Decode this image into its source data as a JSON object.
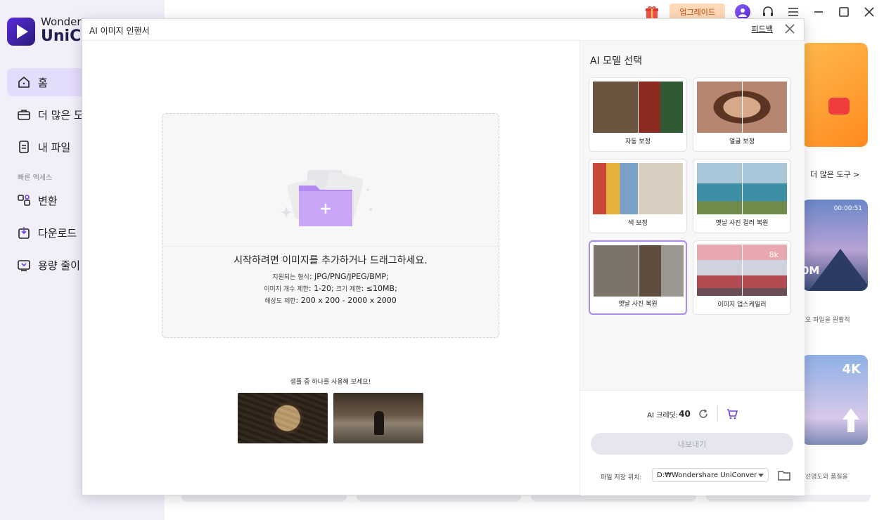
{
  "app": {
    "brand_line1": "Wonders",
    "brand_line2": "UniCo",
    "upgrade_label": "업그레이드",
    "accent_color": "#6b3fe0"
  },
  "sidebar": {
    "items": [
      {
        "label": "홈",
        "icon": "home-icon"
      },
      {
        "label": "더 많은 도",
        "icon": "toolbox-icon"
      },
      {
        "label": "내 파일",
        "icon": "file-icon"
      }
    ],
    "quick_access_label": "빠른 엑세스",
    "quick_items": [
      {
        "label": "변환",
        "icon": "convert-icon"
      },
      {
        "label": "다운로드",
        "icon": "download-icon"
      },
      {
        "label": "용량 줄이",
        "icon": "compress-icon"
      }
    ]
  },
  "background": {
    "more_tools": "더 많은 도구 >",
    "card1_time": "00:00:51",
    "card1_text": "0M",
    "card1_caption": "오 파일을 원활적",
    "card2_badge": "4K",
    "card2_caption": "선명도와 품질을"
  },
  "modal": {
    "title": "AI 이미지 인핸서",
    "feedback": "피드백",
    "dropzone": {
      "main_text": "시작하려면 이미지를 추가하거나 드래그하세요.",
      "formats_label": "지원되는 형식",
      "formats_value": ": JPG/PNG/JPEG/BMP;",
      "count_label": "이미지 개수 제한",
      "count_value": ": 1-20;",
      "size_label": " 크기 제한",
      "size_value": ": ≤10MB;",
      "res_label": "해상도 제한",
      "res_value": ": 200 x 200 - 2000 x 2000"
    },
    "samples_label": "샘플 중 하나를 사용해 보세요!",
    "models_title": "AI 모델 선택",
    "models": [
      {
        "label": "자동 보정"
      },
      {
        "label": "얼굴 보정"
      },
      {
        "label": "색 보정"
      },
      {
        "label": "옛날 사진 컬러 복원"
      },
      {
        "label": "옛날 사진 복원",
        "selected": true
      },
      {
        "label": "이미지 업스케일러",
        "badge": "8k"
      }
    ],
    "credits_label": "AI 크레딧:",
    "credits_value": "40",
    "export_label": "내보내기",
    "save_location_label": "파일 저장 위치:",
    "save_path": "D:₩Wondershare UniConver"
  }
}
